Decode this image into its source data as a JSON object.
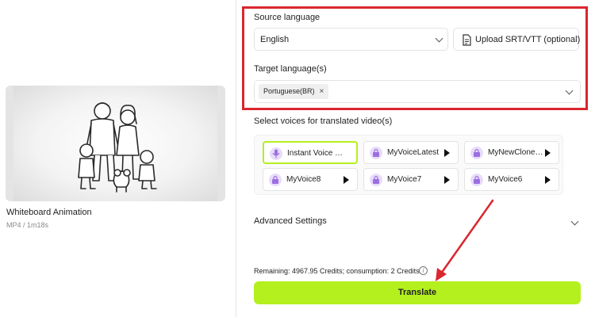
{
  "video": {
    "title": "Whiteboard Animation",
    "meta": "MP4 / 1m18s"
  },
  "source": {
    "label": "Source language",
    "value": "English",
    "upload_label": "Upload SRT/VTT (optional)"
  },
  "target": {
    "label": "Target language(s)",
    "chips": [
      {
        "label": "Portuguese(BR)",
        "remove": "×"
      }
    ]
  },
  "voices": {
    "label": "Select voices for translated video(s)",
    "items": [
      {
        "name": "Instant Voice Clone",
        "selected": true,
        "icon": "mic-icon"
      },
      {
        "name": "MyVoiceLatest",
        "selected": false,
        "icon": "lock-icon"
      },
      {
        "name": "MyNewClone…",
        "selected": false,
        "icon": "lock-icon"
      },
      {
        "name": "MyVoice8",
        "selected": false,
        "icon": "lock-icon"
      },
      {
        "name": "MyVoice7",
        "selected": false,
        "icon": "lock-icon"
      },
      {
        "name": "MyVoice6",
        "selected": false,
        "icon": "lock-icon"
      }
    ]
  },
  "advanced": {
    "label": "Advanced Settings"
  },
  "credits": {
    "text": "Remaining: 4967.95 Credits; consumption: 2 Credits",
    "info": "i"
  },
  "translate": {
    "label": "Translate"
  },
  "colors": {
    "accent": "#b4f01e",
    "highlight": "#d9262e",
    "voice_icon_bg": "#e8dcfa",
    "voice_icon_fg": "#9b6fe0"
  }
}
